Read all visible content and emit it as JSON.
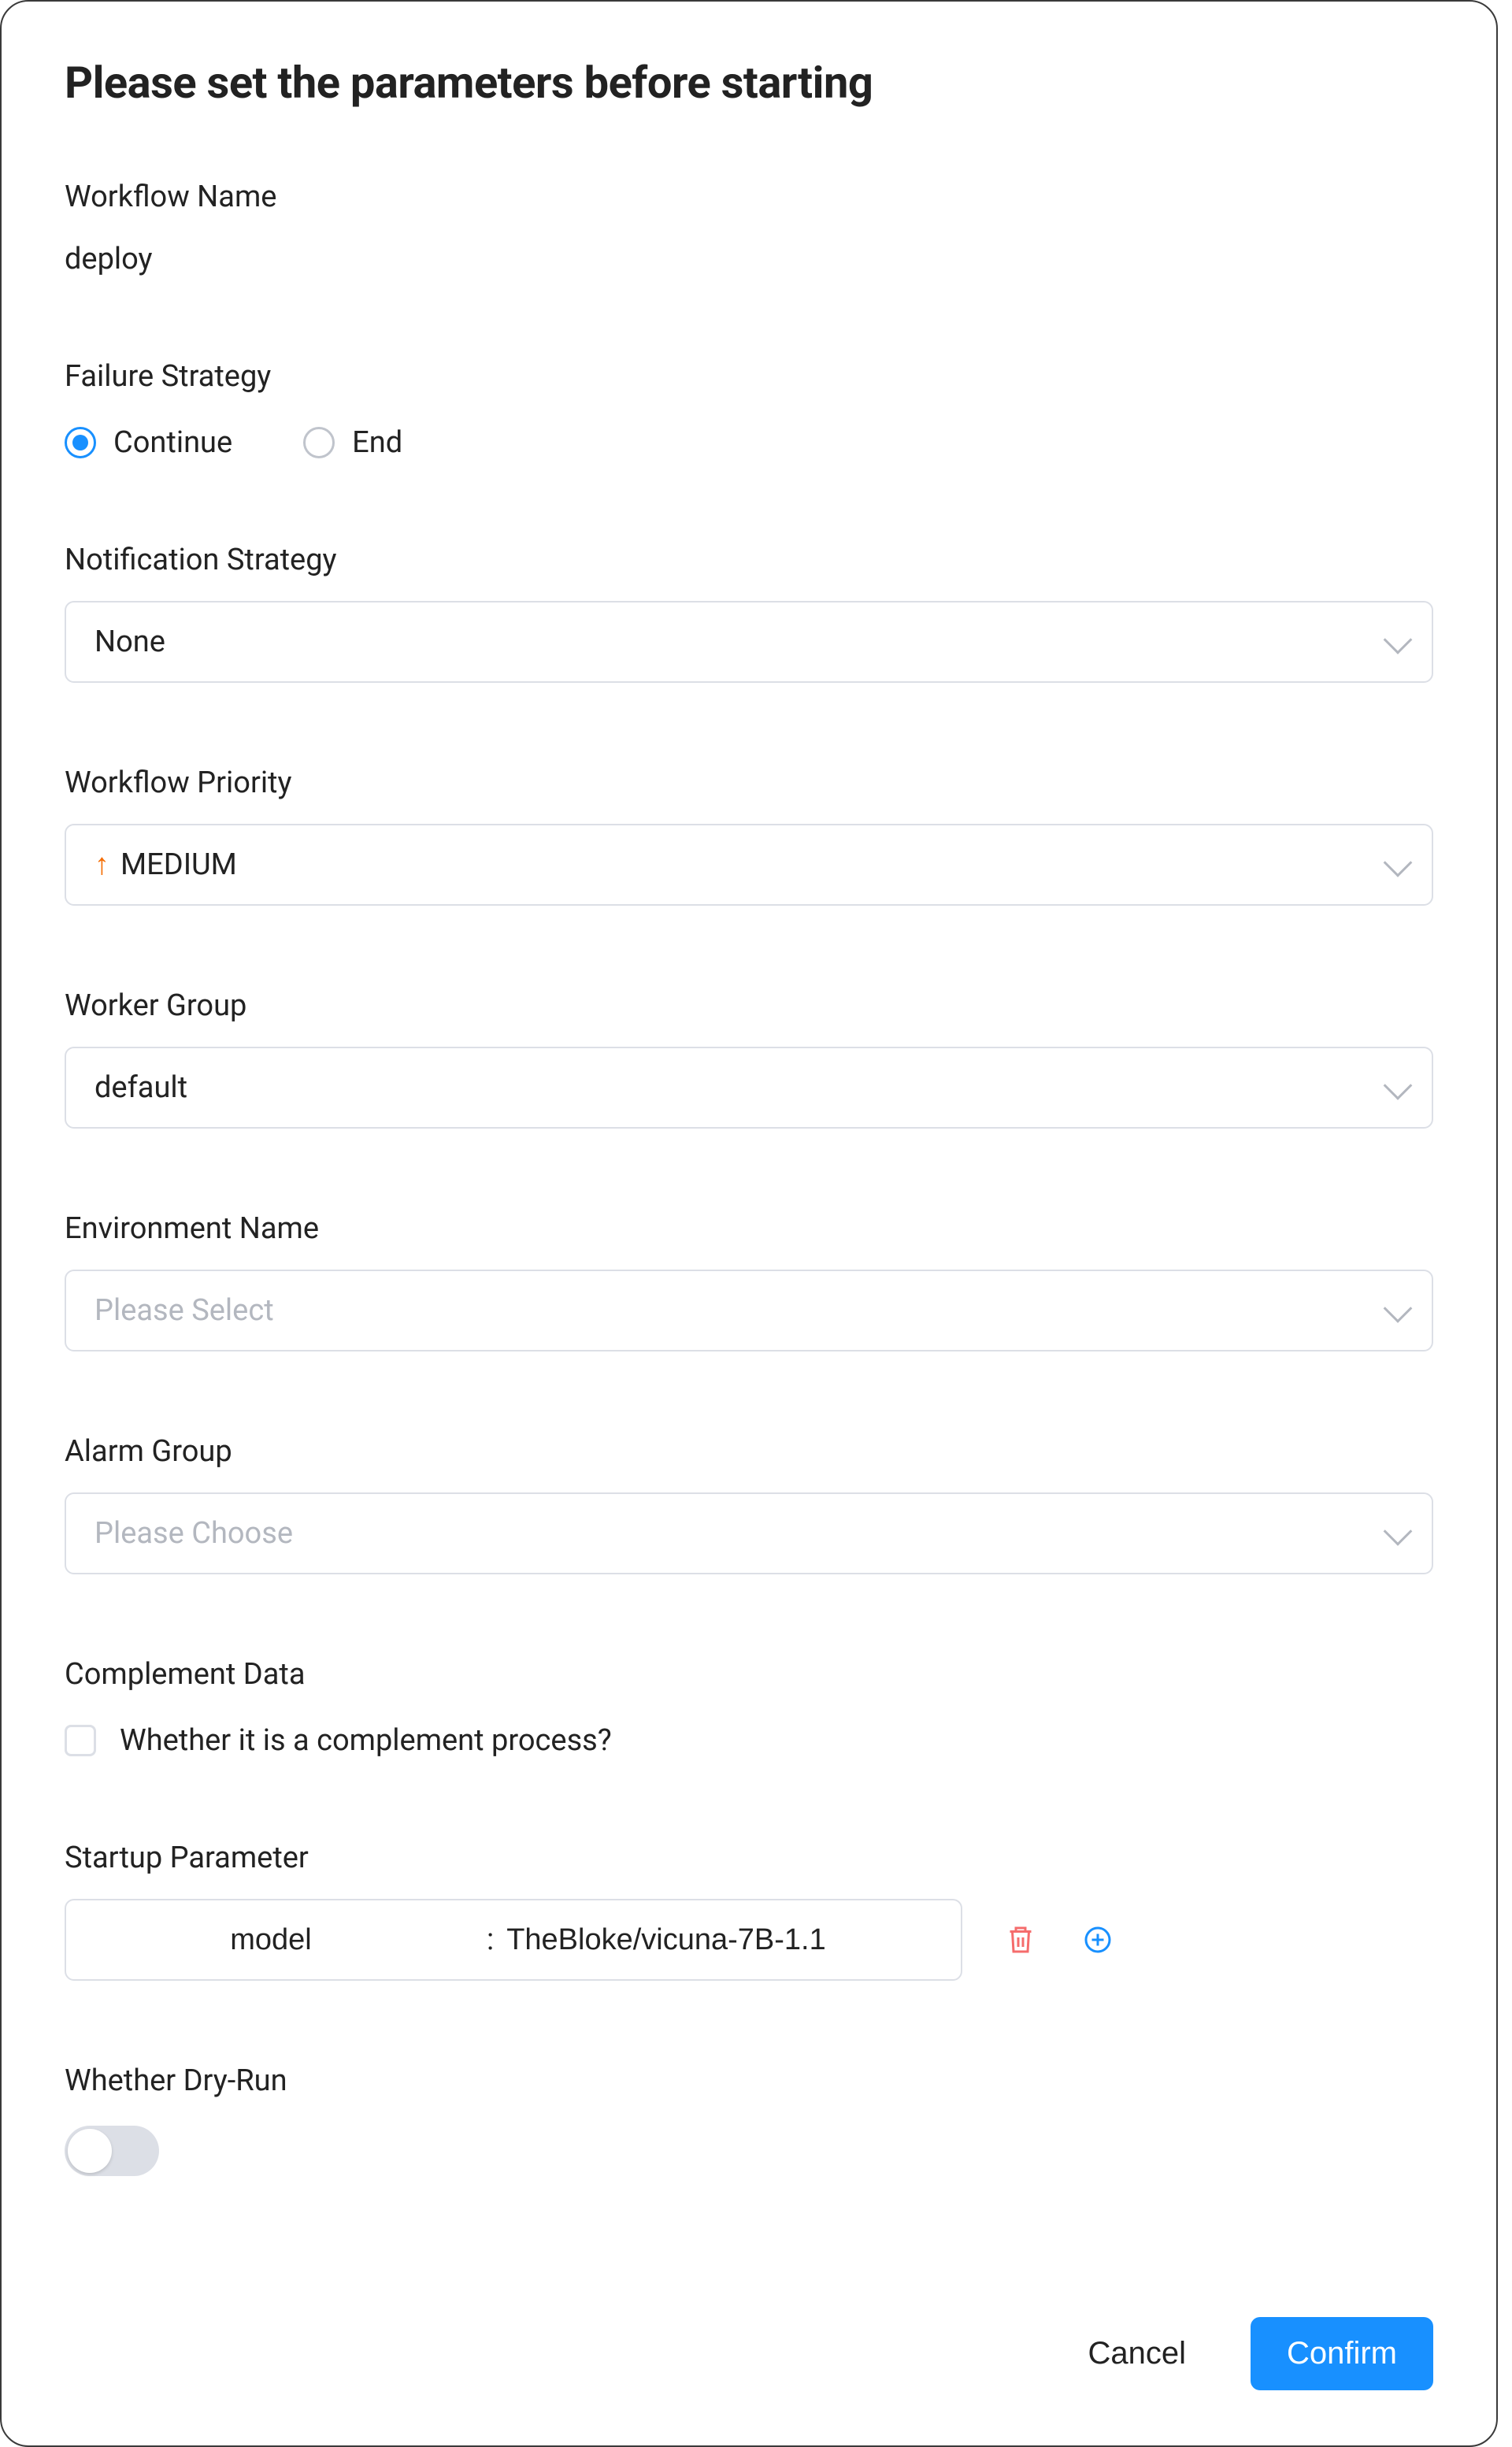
{
  "modal": {
    "title": "Please set the parameters before starting"
  },
  "workflow_name": {
    "label": "Workflow Name",
    "value": "deploy"
  },
  "failure_strategy": {
    "label": "Failure Strategy",
    "options": {
      "continue": "Continue",
      "end": "End"
    },
    "selected": "continue"
  },
  "notification_strategy": {
    "label": "Notification Strategy",
    "value": "None"
  },
  "workflow_priority": {
    "label": "Workflow Priority",
    "value": "MEDIUM",
    "arrow": "↑"
  },
  "worker_group": {
    "label": "Worker Group",
    "value": "default"
  },
  "environment_name": {
    "label": "Environment Name",
    "placeholder": "Please Select"
  },
  "alarm_group": {
    "label": "Alarm Group",
    "placeholder": "Please Choose"
  },
  "complement_data": {
    "label": "Complement Data",
    "checkbox_label": "Whether it is a complement process?",
    "checked": false
  },
  "startup_parameter": {
    "label": "Startup Parameter",
    "rows": [
      {
        "key": "model",
        "value": "TheBloke/vicuna-7B-1.1"
      }
    ]
  },
  "dry_run": {
    "label": "Whether Dry-Run",
    "enabled": false
  },
  "footer": {
    "cancel": "Cancel",
    "confirm": "Confirm"
  }
}
